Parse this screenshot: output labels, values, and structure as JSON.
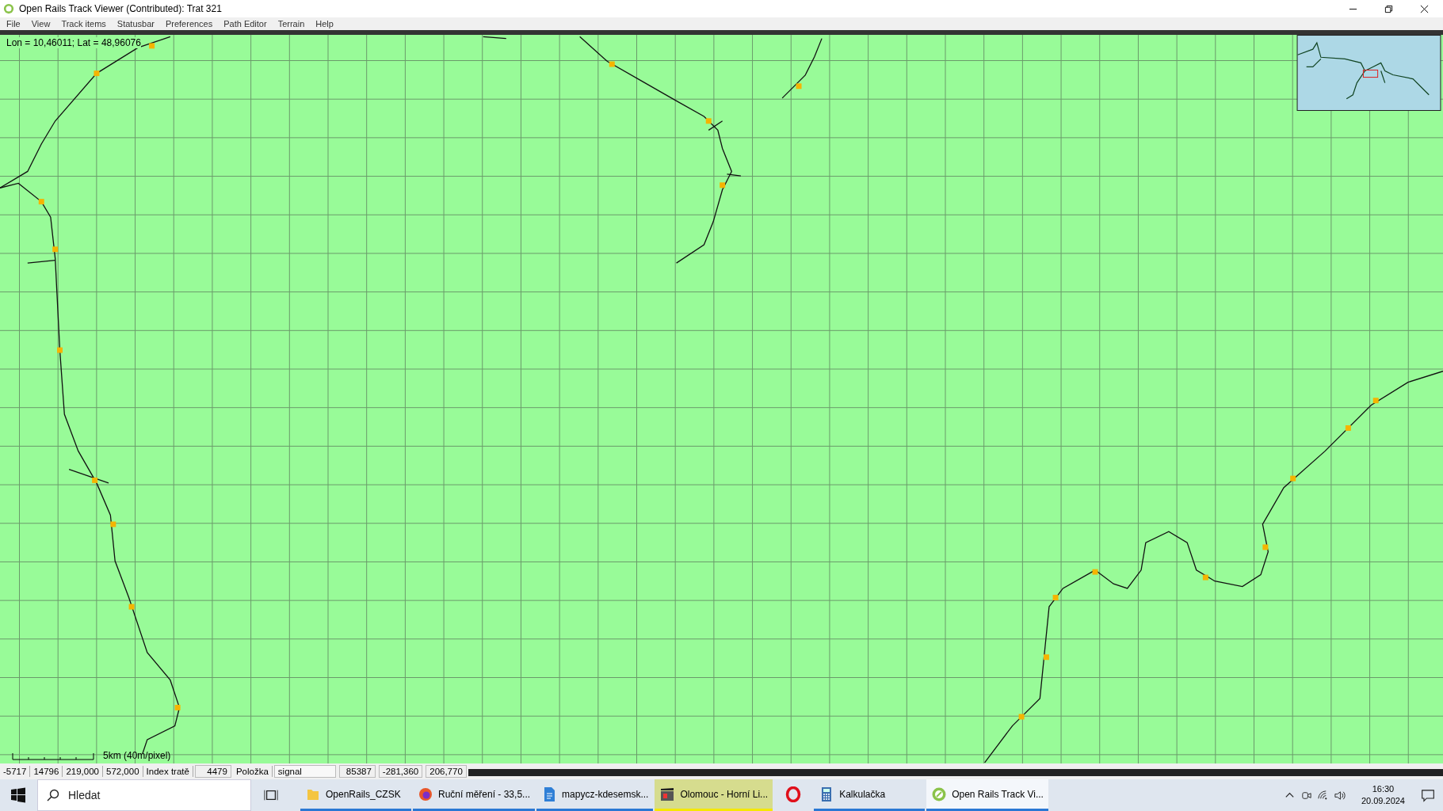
{
  "window": {
    "title": "Open Rails Track Viewer (Contributed): Trat 321"
  },
  "menu": [
    "File",
    "View",
    "Track items",
    "Statusbar",
    "Preferences",
    "Path Editor",
    "Terrain",
    "Help"
  ],
  "map": {
    "coordinates": "Lon = 10,46011; Lat = 48,96076",
    "scale_label": "5km (40m/pixel)"
  },
  "status_bar": [
    {
      "kind": "value",
      "text": "-5717"
    },
    {
      "kind": "value",
      "text": "14796"
    },
    {
      "kind": "value",
      "text": "219,000"
    },
    {
      "kind": "value",
      "text": "572,000"
    },
    {
      "kind": "label",
      "text": "Index tratě"
    },
    {
      "kind": "field",
      "text": "4479"
    },
    {
      "kind": "label",
      "text": "Položka"
    },
    {
      "kind": "wide",
      "text": "signal"
    },
    {
      "kind": "field",
      "text": "85387"
    },
    {
      "kind": "field",
      "text": "-281,360"
    },
    {
      "kind": "field",
      "text": "206,770"
    }
  ],
  "taskbar": {
    "search": {
      "placeholder": "Hledat"
    },
    "apps": [
      {
        "kind": "folder",
        "label": "OpenRails_CZSK",
        "selected": false,
        "flashing": false
      },
      {
        "kind": "browser",
        "label": "Ruční měření - 33,5...",
        "selected": false,
        "flashing": false
      },
      {
        "kind": "document",
        "label": "mapycz-kdesemsk...",
        "selected": false,
        "flashing": false
      },
      {
        "kind": "media",
        "label": "Olomouc - Horní Li...",
        "selected": false,
        "flashing": true
      },
      {
        "kind": "opera",
        "selected": false,
        "flashing": false
      },
      {
        "kind": "calculator",
        "label": "Kalkulačka",
        "selected": false,
        "flashing": false
      },
      {
        "kind": "viewer",
        "label": "Open Rails Track Vi...",
        "selected": true,
        "flashing": false
      }
    ],
    "clock": {
      "time": "16:30",
      "date": "20.09.2024"
    }
  }
}
